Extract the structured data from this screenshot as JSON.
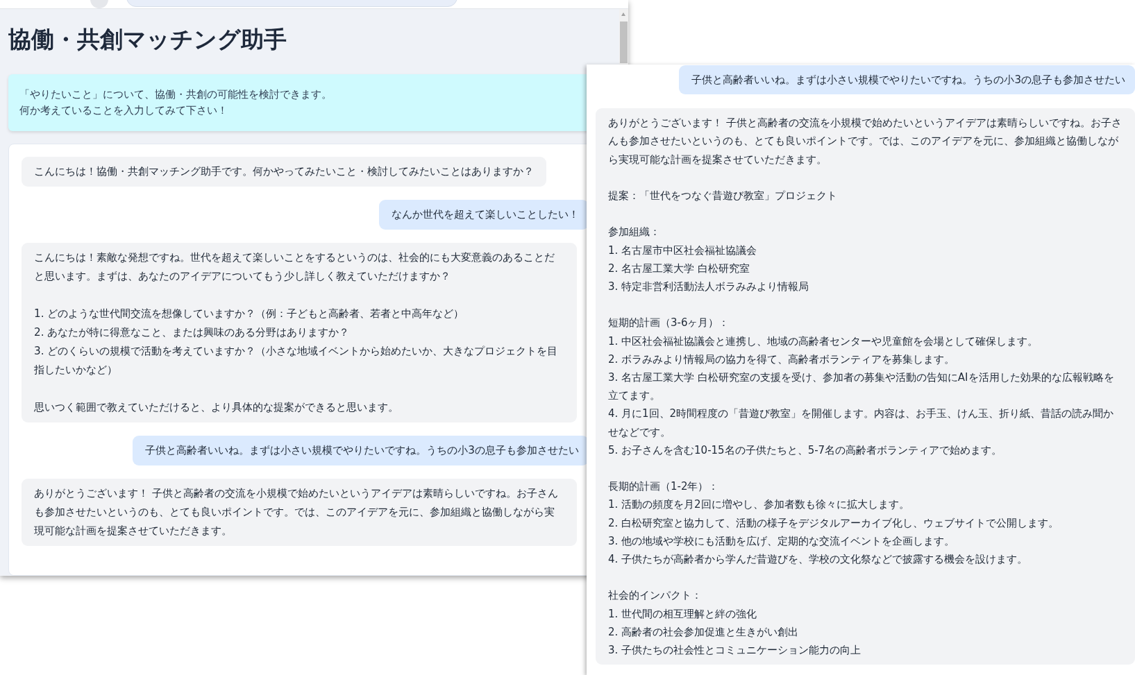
{
  "left_window": {
    "title": "協働・共創マッチング助手",
    "notice": [
      "「やりたいこと」について、協働・共創の可能性を検討できます。",
      "何か考えていることを入力してみて下さい！"
    ],
    "messages": [
      {
        "kind": "assistant",
        "blocks": [
          [
            "こんにちは！協働・共創マッチング助手です。何かやってみたいこと・検討してみたいことはありますか？"
          ]
        ]
      },
      {
        "kind": "user",
        "blocks": [
          [
            "なんか世代を超えて楽しいことしたい！"
          ]
        ]
      },
      {
        "kind": "assistant",
        "blocks": [
          [
            "こんにちは！素敵な発想ですね。世代を超えて楽しいことをするというのは、社会的にも大変意義のあることだと思います。まずは、あなたのアイデアについてもう少し詳しく教えていただけますか？"
          ],
          [
            "1. どのような世代間交流を想像していますか？（例：子どもと高齢者、若者と中高年など）",
            "2. あなたが特に得意なこと、または興味のある分野はありますか？",
            "3. どのくらいの規模で活動を考えていますか？（小さな地域イベントから始めたいか、大きなプロジェクトを目指したいかなど）"
          ],
          [
            "思いつく範囲で教えていただけると、より具体的な提案ができると思います。"
          ]
        ]
      },
      {
        "kind": "user",
        "blocks": [
          [
            "子供と高齢者いいね。まずは小さい規模でやりたいですね。うちの小3の息子も参加させたい"
          ]
        ]
      },
      {
        "kind": "assistant",
        "blocks": [
          [
            "ありがとうございます！ 子供と高齢者の交流を小規模で始めたいというアイデアは素晴らしいですね。お子さんも参加させたいというのも、とても良いポイントです。では、このアイデアを元に、参加組織と協働しながら実現可能な計画を提案させていただきます。"
          ]
        ]
      }
    ]
  },
  "right_window": {
    "messages": [
      {
        "kind": "user",
        "blocks": [
          [
            "子供と高齢者いいね。まずは小さい規模でやりたいですね。うちの小3の息子も参加させたい"
          ]
        ]
      },
      {
        "kind": "assistant",
        "blocks": [
          [
            "ありがとうございます！ 子供と高齢者の交流を小規模で始めたいというアイデアは素晴らしいですね。お子さんも参加させたいというのも、とても良いポイントです。では、このアイデアを元に、参加組織と協働しながら実現可能な計画を提案させていただきます。"
          ],
          [
            "提案：「世代をつなぐ昔遊び教室」プロジェクト"
          ],
          [
            "参加組織：",
            "1. 名古屋市中区社会福祉協議会",
            "2. 名古屋工業大学 白松研究室",
            "3. 特定非営利活動法人ボラみみより情報局"
          ],
          [
            "短期的計画（3-6ヶ月）：",
            "1. 中区社会福祉協議会と連携し、地域の高齢者センターや児童館を会場として確保します。",
            "2. ボラみみより情報局の協力を得て、高齢者ボランティアを募集します。",
            "3. 名古屋工業大学 白松研究室の支援を受け、参加者の募集や活動の告知にAIを活用した効果的な広報戦略を立てます。",
            "4. 月に1回、2時間程度の「昔遊び教室」を開催します。内容は、お手玉、けん玉、折り紙、昔話の読み聞かせなどです。",
            "5. お子さんを含む10-15名の子供たちと、5-7名の高齢者ボランティアで始めます。"
          ],
          [
            "長期的計画（1-2年）：",
            "1. 活動の頻度を月2回に増やし、参加者数も徐々に拡大します。",
            "2. 白松研究室と協力して、活動の様子をデジタルアーカイブ化し、ウェブサイトで公開します。",
            "3. 他の地域や学校にも活動を広げ、定期的な交流イベントを企画します。",
            "4. 子供たちが高齢者から学んだ昔遊びを、学校の文化祭などで披露する機会を設けます。"
          ],
          [
            "社会的インパクト：",
            "1. 世代間の相互理解と絆の強化",
            "2. 高齢者の社会参加促進と生きがい創出",
            "3. 子供たちの社会性とコミュニケーション能力の向上"
          ]
        ]
      }
    ]
  }
}
